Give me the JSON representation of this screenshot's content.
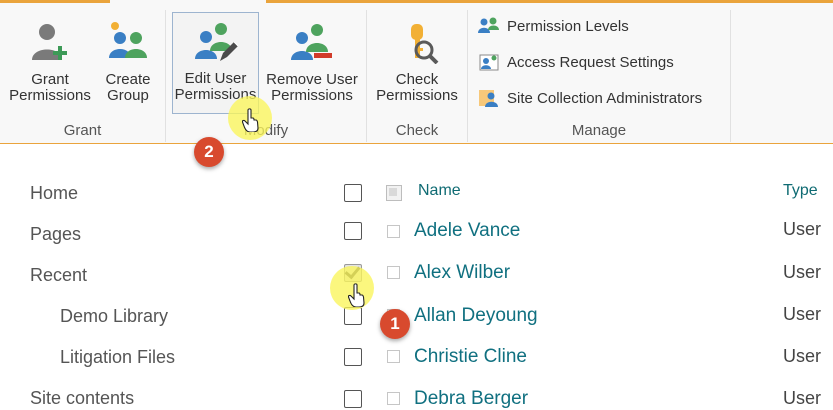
{
  "ribbon": {
    "grant": {
      "group_label": "Grant",
      "grant_permissions": "Grant Permissions",
      "create_group": "Create Group"
    },
    "modify": {
      "group_label": "Modify",
      "edit_user_permissions": "Edit User Permissions",
      "remove_user_permissions": "Remove User Permissions"
    },
    "check": {
      "group_label": "Check",
      "check_permissions": "Check Permissions"
    },
    "manage": {
      "group_label": "Manage",
      "permission_levels": "Permission Levels",
      "access_request_settings": "Access Request Settings",
      "site_collection_administrators": "Site Collection Administrators"
    }
  },
  "nav": {
    "items": [
      {
        "label": "Home"
      },
      {
        "label": "Pages"
      },
      {
        "label": "Recent"
      },
      {
        "label": "Demo Library"
      },
      {
        "label": "Litigation Files"
      },
      {
        "label": "Site contents"
      }
    ]
  },
  "list": {
    "columns": {
      "name": "Name",
      "type": "Type"
    },
    "rows": [
      {
        "name": "Adele Vance",
        "type": "User",
        "checked": false
      },
      {
        "name": "Alex Wilber",
        "type": "User",
        "checked": true
      },
      {
        "name": "Allan Deyoung",
        "type": "User",
        "checked": false
      },
      {
        "name": "Christie Cline",
        "type": "User",
        "checked": false
      },
      {
        "name": "Debra Berger",
        "type": "User",
        "checked": false
      }
    ]
  },
  "annotations": {
    "step1": "1",
    "step2": "2"
  },
  "colors": {
    "accent": "#eaa43c",
    "link": "#107080",
    "badge": "#d84a2e",
    "highlight": "#faf55a"
  }
}
